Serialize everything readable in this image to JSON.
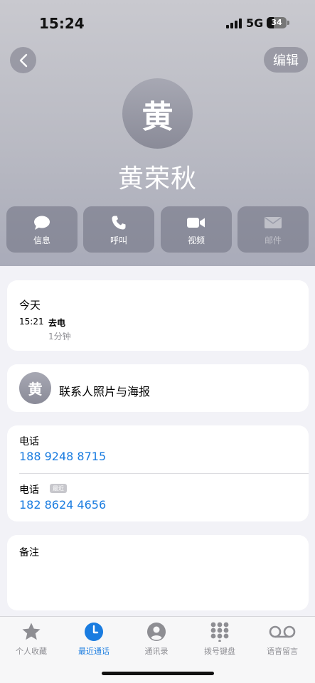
{
  "status_bar": {
    "time": "15:24",
    "network": "5G",
    "battery": "34"
  },
  "header": {
    "edit_label": "编辑",
    "avatar_initial": "黄",
    "name": "黄荣秋",
    "actions": [
      {
        "label": "信息",
        "icon": "message-icon"
      },
      {
        "label": "呼叫",
        "icon": "phone-icon"
      },
      {
        "label": "视频",
        "icon": "video-icon"
      },
      {
        "label": "邮件",
        "icon": "mail-icon",
        "disabled": true
      }
    ]
  },
  "recent_calls": {
    "heading": "今天",
    "time": "15:21",
    "type": "去电",
    "duration": "1分钟"
  },
  "poster": {
    "avatar_initial": "黄",
    "label": "联系人照片与海报"
  },
  "phones": [
    {
      "label": "电话",
      "number": "188 9248 8715"
    },
    {
      "label": "电话",
      "badge": "最近",
      "number": "182 8624 4656"
    }
  ],
  "notes": {
    "label": "备注"
  },
  "tabbar": {
    "tabs": [
      {
        "label": "个人收藏",
        "icon": "star-icon"
      },
      {
        "label": "最近通话",
        "icon": "clock-icon",
        "active": true
      },
      {
        "label": "通讯录",
        "icon": "person-icon"
      },
      {
        "label": "拨号键盘",
        "icon": "keypad-icon"
      },
      {
        "label": "语音留言",
        "icon": "voicemail-icon"
      }
    ]
  },
  "colors": {
    "accent": "#1a7ce0",
    "header_bg": "#b9bac3"
  }
}
